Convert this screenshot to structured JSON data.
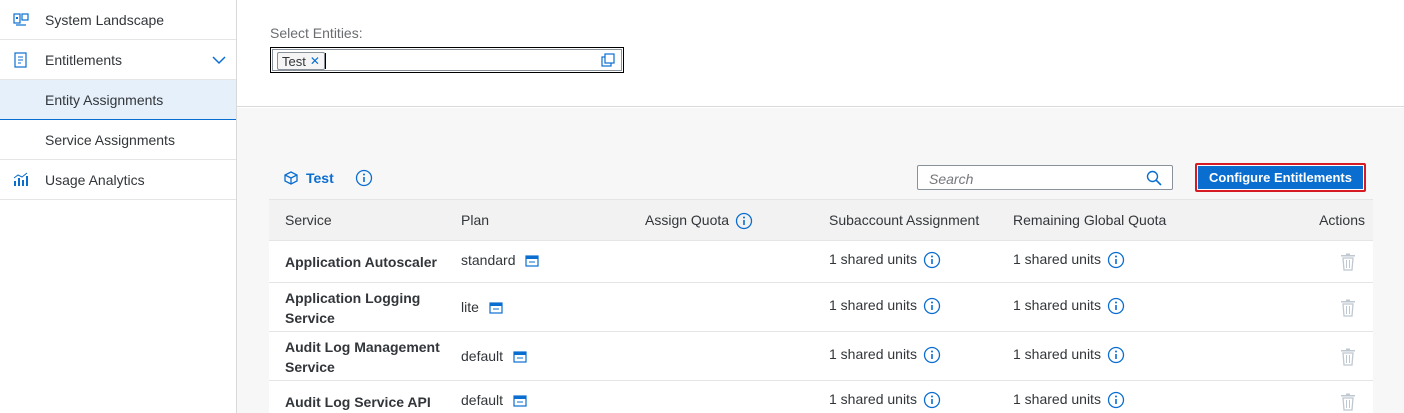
{
  "sidebar": {
    "items": [
      {
        "label": "System Landscape",
        "icon": "system-landscape-icon"
      },
      {
        "label": "Entitlements",
        "icon": "entitlements-icon",
        "expanded": true
      },
      {
        "label": "Entity Assignments",
        "selected": true
      },
      {
        "label": "Service Assignments"
      },
      {
        "label": "Usage Analytics",
        "icon": "usage-analytics-icon"
      }
    ]
  },
  "header": {
    "select_label": "Select Entities:",
    "token": "Test"
  },
  "toolbar": {
    "title": "Test",
    "search_placeholder": "Search",
    "configure_button": "Configure Entitlements"
  },
  "table": {
    "columns": [
      "Service",
      "Plan",
      "Assign Quota",
      "Subaccount Assignment",
      "Remaining Global Quota",
      "Actions"
    ],
    "rows": [
      {
        "service": "Application Autoscaler",
        "plan": "standard",
        "subaccount": "1 shared units",
        "remaining": "1 shared units"
      },
      {
        "service": "Application Logging Service",
        "plan": "lite",
        "subaccount": "1 shared units",
        "remaining": "1 shared units"
      },
      {
        "service": "Audit Log Management Service",
        "plan": "default",
        "subaccount": "1 shared units",
        "remaining": "1 shared units"
      },
      {
        "service": "Audit Log Service API",
        "plan": "default",
        "subaccount": "1 shared units",
        "remaining": "1 shared units"
      }
    ]
  },
  "colors": {
    "accent": "#0a6ed1",
    "highlight_border": "#d61b25",
    "selected_bg": "#e5f0fa"
  }
}
